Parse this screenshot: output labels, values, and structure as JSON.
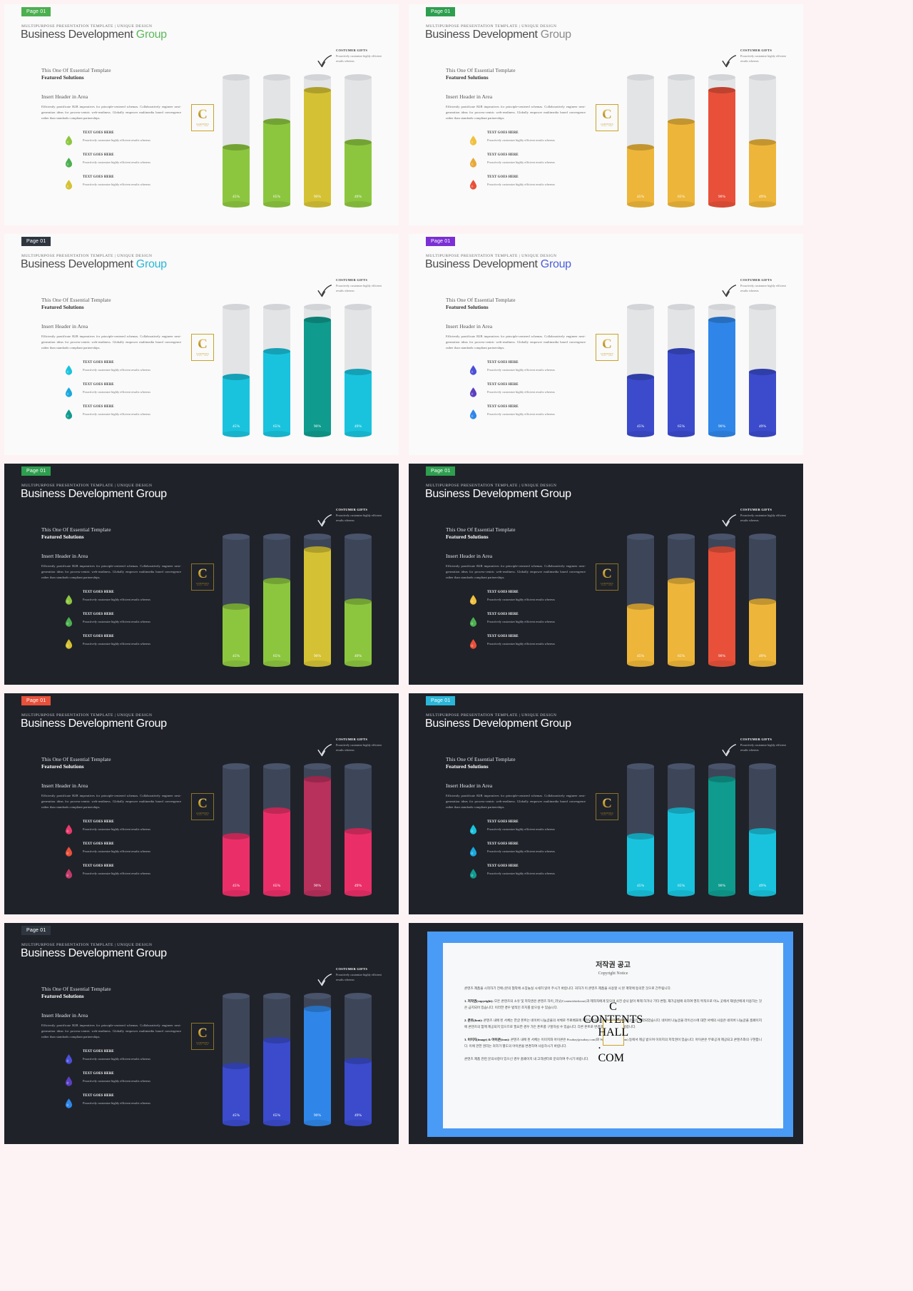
{
  "slides": [
    {
      "page_label": "Page 01",
      "badge_color": "#4caf50",
      "theme": "light",
      "kicker": "MULTIPURPOSE PRESENTATION TEMPLATE | UNIQUE DESIGN",
      "title_main": "Business Development",
      "title_accent": "Group",
      "accent_color": "#5cb85c",
      "sub1": "This One Of Essential  Template",
      "sub2": "Featured Solutions",
      "sub3": "Insert Header  in Area",
      "paragraph": "Efficiently pontificate B2B imperatives for principle-centered schemas. Collaboratively engineer next-generation ideas for process-centric web-readiness. Globally empower multimedia based convergence rather than standards compliant partnerships.",
      "legend": [
        {
          "title": "TEXT GOES HERE",
          "desc": "Proactively customize highly efficient results whereas",
          "color": "#8cc63f"
        },
        {
          "title": "TEXT GOES HERE",
          "desc": "Proactively customize highly efficient results whereas",
          "color": "#4caf50"
        },
        {
          "title": "TEXT GOES HERE",
          "desc": "Proactively customize highly efficient results whereas",
          "color": "#d4c234"
        }
      ],
      "callout_title": "COSTUMER GIFTS",
      "callout_desc": "Proactively customize highly efficient results whereas",
      "bar_colors": [
        "#8cc63f",
        "#8cc63f",
        "#d4c234",
        "#8cc63f"
      ]
    },
    {
      "page_label": "Page 01",
      "badge_color": "#2e9e4f",
      "theme": "light",
      "kicker": "MULTIPURPOSE PRESENTATION TEMPLATE | UNIQUE DESIGN",
      "title_main": "Business Development",
      "title_accent": "Group",
      "accent_color": "#8c8c8c",
      "sub1": "This One Of Essential  Template",
      "sub2": "Featured Solutions",
      "sub3": "Insert Header  in Area",
      "paragraph": "Efficiently pontificate B2B imperatives for principle-centered schemas. Collaboratively engineer next-generation ideas for process-centric web-readiness. Globally empower multimedia based convergence rather than standards compliant partnerships.",
      "legend": [
        {
          "title": "TEXT GOES HERE",
          "desc": "Proactively customize highly efficient results whereas",
          "color": "#f0c040"
        },
        {
          "title": "TEXT GOES HERE",
          "desc": "Proactively customize highly efficient results whereas",
          "color": "#e8a93a"
        },
        {
          "title": "TEXT GOES HERE",
          "desc": "Proactively customize highly efficient results whereas",
          "color": "#e8503a"
        }
      ],
      "callout_title": "COSTUMER GIFTS",
      "callout_desc": "Proactively customize highly efficient results whereas",
      "bar_colors": [
        "#edb63a",
        "#edb63a",
        "#e8503a",
        "#edb63a"
      ]
    },
    {
      "page_label": "Page 01",
      "badge_color": "#2f3640",
      "theme": "light",
      "kicker": "MULTIPURPOSE PRESENTATION TEMPLATE | UNIQUE DESIGN",
      "title_main": "Business Development",
      "title_accent": "Group",
      "accent_color": "#29b6d8",
      "sub1": "This One Of Essential  Template",
      "sub2": "Featured Solutions",
      "sub3": "Insert Header  in Area",
      "paragraph": "Efficiently pontificate B2B imperatives for principle-centered schemas. Collaboratively engineer next-generation ideas for process-centric web-readiness. Globally empower multimedia based convergence rather than standards compliant partnerships.",
      "legend": [
        {
          "title": "TEXT GOES HERE",
          "desc": "Proactively customize highly efficient results whereas",
          "color": "#19c3dd"
        },
        {
          "title": "TEXT GOES HERE",
          "desc": "Proactively customize highly efficient results whereas",
          "color": "#19a8dd"
        },
        {
          "title": "TEXT GOES HERE",
          "desc": "Proactively customize highly efficient results whereas",
          "color": "#0f9b8e"
        }
      ],
      "callout_title": "COSTUMER GIFTS",
      "callout_desc": "Proactively customize highly efficient results whereas",
      "bar_colors": [
        "#19c3dd",
        "#19c3dd",
        "#0f9b8e",
        "#19c3dd"
      ]
    },
    {
      "page_label": "Page 01",
      "badge_color": "#7b2fd4",
      "theme": "light",
      "kicker": "MULTIPURPOSE PRESENTATION TEMPLATE | UNIQUE DESIGN",
      "title_main": "Business Development",
      "title_accent": "Group",
      "accent_color": "#4a5fd8",
      "sub1": "This One Of Essential  Template",
      "sub2": "Featured Solutions",
      "sub3": "Insert Header  in Area",
      "paragraph": "Efficiently pontificate B2B imperatives for principle-centered schemas. Collaboratively engineer next-generation ideas for process-centric web-readiness. Globally empower multimedia based convergence rather than standards compliant partnerships.",
      "legend": [
        {
          "title": "TEXT GOES HERE",
          "desc": "Proactively customize highly efficient results whereas",
          "color": "#4a4fd8"
        },
        {
          "title": "TEXT GOES HERE",
          "desc": "Proactively customize highly efficient results whereas",
          "color": "#5b3fc0"
        },
        {
          "title": "TEXT GOES HERE",
          "desc": "Proactively customize highly efficient results whereas",
          "color": "#2f86e8"
        }
      ],
      "callout_title": "COSTUMER GIFTS",
      "callout_desc": "Proactively customize highly efficient results whereas",
      "bar_colors": [
        "#3b4bcc",
        "#3b4bcc",
        "#2f86e8",
        "#3b4bcc"
      ]
    },
    {
      "page_label": "Page 01",
      "badge_color": "#2e9e4f",
      "theme": "dark",
      "kicker": "MULTIPURPOSE PRESENTATION TEMPLATE | UNIQUE DESIGN",
      "title_main": "Business Development Group",
      "title_accent": "",
      "accent_color": "#ffffff",
      "sub1": "This One Of Essential  Template",
      "sub2": "Featured Solutions",
      "sub3": "Insert Header  in Area",
      "paragraph": "Efficiently pontificate B2B imperatives for principle-centered schemas. Collaboratively engineer next-generation ideas for process-centric web-readiness. Globally empower multimedia based convergence rather than standards compliant partnerships.",
      "legend": [
        {
          "title": "TEXT GOES HERE",
          "desc": "Proactively customize highly efficient results whereas",
          "color": "#8cc63f"
        },
        {
          "title": "TEXT GOES HERE",
          "desc": "Proactively customize highly efficient results whereas",
          "color": "#4caf50"
        },
        {
          "title": "TEXT GOES HERE",
          "desc": "Proactively customize highly efficient results whereas",
          "color": "#d4c234"
        }
      ],
      "callout_title": "COSTUMER GIFTS",
      "callout_desc": "Proactively customize highly efficient results whereas",
      "bar_colors": [
        "#8cc63f",
        "#8cc63f",
        "#d4c234",
        "#8cc63f"
      ]
    },
    {
      "page_label": "Page 01",
      "badge_color": "#2e9e4f",
      "theme": "dark",
      "kicker": "MULTIPURPOSE PRESENTATION TEMPLATE | UNIQUE DESIGN",
      "title_main": "Business Development Group",
      "title_accent": "",
      "accent_color": "#ffffff",
      "sub1": "This One Of Essential  Template",
      "sub2": "Featured Solutions",
      "sub3": "Insert Header  in Area",
      "paragraph": "Efficiently pontificate B2B imperatives for principle-centered schemas. Collaboratively engineer next-generation ideas for process-centric web-readiness. Globally empower multimedia based convergence rather than standards compliant partnerships.",
      "legend": [
        {
          "title": "TEXT GOES HERE",
          "desc": "Proactively customize highly efficient results whereas",
          "color": "#f0c040"
        },
        {
          "title": "TEXT GOES HERE",
          "desc": "Proactively customize highly efficient results whereas",
          "color": "#4caf50"
        },
        {
          "title": "TEXT GOES HERE",
          "desc": "Proactively customize highly efficient results whereas",
          "color": "#e8503a"
        }
      ],
      "callout_title": "COSTUMER GIFTS",
      "callout_desc": "Proactively customize highly efficient results whereas",
      "bar_colors": [
        "#edb63a",
        "#edb63a",
        "#e8503a",
        "#edb63a"
      ]
    },
    {
      "page_label": "Page 01",
      "badge_color": "#e8503a",
      "theme": "dark",
      "kicker": "MULTIPURPOSE PRESENTATION TEMPLATE | UNIQUE DESIGN",
      "title_main": "Business Development Group",
      "title_accent": "",
      "accent_color": "#ffffff",
      "sub1": "This One Of Essential  Template",
      "sub2": "Featured Solutions",
      "sub3": "Insert Header  in Area",
      "paragraph": "Efficiently pontificate B2B imperatives for principle-centered schemas. Collaboratively engineer next-generation ideas for process-centric web-readiness. Globally empower multimedia based convergence rather than standards compliant partnerships.",
      "legend": [
        {
          "title": "TEXT GOES HERE",
          "desc": "Proactively customize highly efficient results whereas",
          "color": "#e83a6a"
        },
        {
          "title": "TEXT GOES HERE",
          "desc": "Proactively customize highly efficient results whereas",
          "color": "#e8503a"
        },
        {
          "title": "TEXT GOES HERE",
          "desc": "Proactively customize highly efficient results whereas",
          "color": "#c23a6a"
        }
      ],
      "callout_title": "COSTUMER GIFTS",
      "callout_desc": "Proactively customize highly efficient results whereas",
      "bar_colors": [
        "#ea2f68",
        "#ea2f68",
        "#b8305c",
        "#ea2f68"
      ]
    },
    {
      "page_label": "Page 01",
      "badge_color": "#29b6d8",
      "theme": "dark",
      "kicker": "MULTIPURPOSE PRESENTATION TEMPLATE | UNIQUE DESIGN",
      "title_main": "Business Development Group",
      "title_accent": "",
      "accent_color": "#ffffff",
      "sub1": "This One Of Essential  Template",
      "sub2": "Featured Solutions",
      "sub3": "Insert Header  in Area",
      "paragraph": "Efficiently pontificate B2B imperatives for principle-centered schemas. Collaboratively engineer next-generation ideas for process-centric web-readiness. Globally empower multimedia based convergence rather than standards compliant partnerships.",
      "legend": [
        {
          "title": "TEXT GOES HERE",
          "desc": "Proactively customize highly efficient results whereas",
          "color": "#19c3dd"
        },
        {
          "title": "TEXT GOES HERE",
          "desc": "Proactively customize highly efficient results whereas",
          "color": "#19a8dd"
        },
        {
          "title": "TEXT GOES HERE",
          "desc": "Proactively customize highly efficient results whereas",
          "color": "#0f9b8e"
        }
      ],
      "callout_title": "COSTUMER GIFTS",
      "callout_desc": "Proactively customize highly efficient results whereas",
      "bar_colors": [
        "#19c3dd",
        "#19c3dd",
        "#0f9b8e",
        "#19c3dd"
      ]
    },
    {
      "page_label": "Page 01",
      "badge_color": "#2f3640",
      "theme": "dark",
      "kicker": "MULTIPURPOSE PRESENTATION TEMPLATE | UNIQUE DESIGN",
      "title_main": "Business Development Group",
      "title_accent": "",
      "accent_color": "#ffffff",
      "sub1": "This One Of Essential  Template",
      "sub2": "Featured Solutions",
      "sub3": "Insert Header  in Area",
      "paragraph": "Efficiently pontificate B2B imperatives for principle-centered schemas. Collaboratively engineer next-generation ideas for process-centric web-readiness. Globally empower multimedia based convergence rather than standards compliant partnerships.",
      "legend": [
        {
          "title": "TEXT GOES HERE",
          "desc": "Proactively customize highly efficient results whereas",
          "color": "#4a4fd8"
        },
        {
          "title": "TEXT GOES HERE",
          "desc": "Proactively customize highly efficient results whereas",
          "color": "#5b3fc0"
        },
        {
          "title": "TEXT GOES HERE",
          "desc": "Proactively customize highly efficient results whereas",
          "color": "#2f86e8"
        }
      ],
      "callout_title": "COSTUMER GIFTS",
      "callout_desc": "Proactively customize highly efficient results whereas",
      "bar_colors": [
        "#3b4bcc",
        "#3b4bcc",
        "#2f86e8",
        "#3b4bcc"
      ]
    }
  ],
  "logo": {
    "letter": "C",
    "line1": "CONTENTS",
    "line2": "HALL . COM"
  },
  "chart_data": {
    "type": "bar",
    "categories": [
      "45%",
      "65%",
      "90%",
      "49%"
    ],
    "values": [
      45,
      65,
      90,
      49
    ],
    "labels": [
      "45%",
      "65%",
      "90%",
      "49%"
    ],
    "title": "",
    "xlabel": "",
    "ylabel": "",
    "ylim": [
      0,
      100
    ],
    "grid": false,
    "legend_position": "left",
    "style": "3d-cylinder-progress"
  },
  "copyright": {
    "title": "저작권 공고",
    "subtitle": "Copyright Notice",
    "intro": "콘텐츠 제품을 시작하기 전에 (본의 협악에 소장놀실 시세히 읽어 주시기 바랍니다. 귀하가 이 콘텐츠 제품을 사용할 시 본 계약에 동의한 것으로 간주됩니다.",
    "sections": [
      {
        "num": "1.",
        "heading": "저작권(copyright):",
        "text": "모든 콘텐츠의 소유 및 저작권은 콘텐츠 하이_러닛(Contentshiokeout)과 제작자에게 있으며 사전 승낙 없이 복제 하거나 기타 변형, 재가공법에 의하여 영리 목적으로 어느 곳에서 재생산에게 이용하는 것은 금지되어 있습니다. 이러한 경우 법적인 조치를 받으실 수 있습니다."
      },
      {
        "num": "2.",
        "heading": "폰트(font):",
        "text": "콘텐츠 내에 된 서체는 한글 폰트는 네이버 나눔글꼴의 서체로 무료배포에 제작되었습니다. 한글 외의 서체의 글꼴은 제작되었습니다. 네이버 나눔글꼴 라이선스에 대한 서체의 사용은 네이버 나눔글꼴 홈페이지에 콘텐츠의 함께 제공되지 있으므로 필요한 경우 가든 폰트를 구할하실 수 있습니다. 다른 폰트로 변경하여 사용하시기 바랍니다."
      },
      {
        "num": "3.",
        "heading": "이미지(image) & 아이콘(icon):",
        "text": "콘텐츠 내에 된 서체는 이미지와 아이콘은 Pixabay(pixabay.com)와 Webply(webply.com) 등에서 제공 받으며 이미지의 저작권이 있습니다. 아이콘은 무료공개 제공되고 콘텐츠와의 구현합니다. 이에 관한 권리는 귀하가 별도의 아이콘을 변경하여 사용하시기 바랍니다."
      }
    ],
    "footer": "콘텐츠 제품 관련 문의사항이 있으신 경우 홈페이지 내 고객센터로 문의하여 주시기 바랍니다."
  }
}
